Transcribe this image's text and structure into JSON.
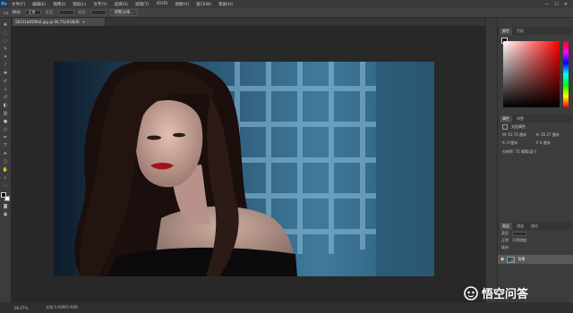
{
  "app": {
    "logo": "Ps"
  },
  "menu": [
    "文件(F)",
    "编辑(E)",
    "图像(I)",
    "图层(L)",
    "文字(Y)",
    "选择(S)",
    "滤镜(T)",
    "3D(D)",
    "视图(V)",
    "窗口(W)",
    "帮助(H)"
  ],
  "window_controls": [
    "—",
    "☐",
    "✕"
  ],
  "options": {
    "style_label": "样式:",
    "style_value": "正常",
    "width_label": "宽度:",
    "height_label": "高度:",
    "refine_button": "调整边缘..."
  },
  "document": {
    "tab_title": "58151b85f0b0.jpg @ 66.7%(RGB/8)",
    "close": "×"
  },
  "status": {
    "zoom": "66.67%",
    "doc_size": "文档:5.93M/5.93M"
  },
  "panels": {
    "color_tabs": [
      "颜色",
      "色板"
    ],
    "props_tabs": [
      "属性",
      "调整"
    ],
    "props_layer_label": "文档属性",
    "props_w": "W: 61.75 厘米",
    "props_h": "H: 35.27 厘米",
    "props_x": "X: 0 厘米",
    "props_y": "Y: 0 厘米",
    "props_res": "分辨率: 72 像素/英寸",
    "layers_tabs": [
      "图层",
      "通道",
      "路径"
    ],
    "layers_kind": "类型",
    "layers_mode": "正常",
    "layers_opacity": "不透明度:",
    "layers_fill": "填充:",
    "layer_name": "背景"
  },
  "watermark": {
    "text": "悟空问答"
  },
  "colors": {
    "accent": "#5fb4ff",
    "panel_bg": "#3c3c3c",
    "canvas_bg": "#282828"
  }
}
